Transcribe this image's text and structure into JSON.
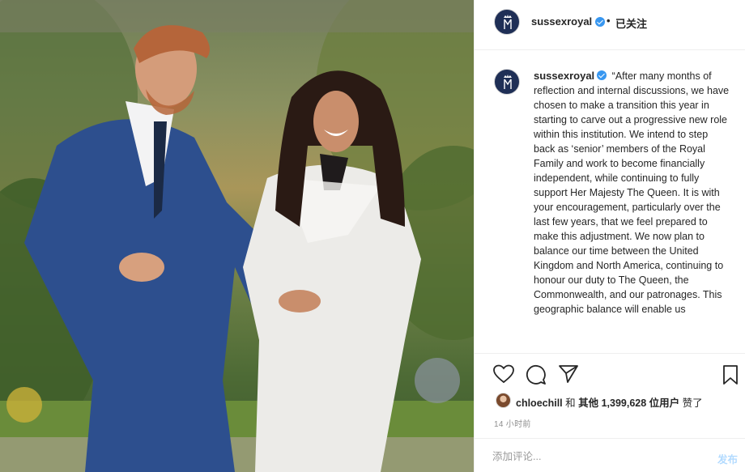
{
  "post": {
    "username": "sussexroyal",
    "follow_status": "已关注",
    "separator": "•",
    "caption_text": "“After many months of reflection and internal discussions, we have chosen to make a transition this year in starting to carve out a progressive new role within this institution. We intend to step back as ‘senior’ members of the Royal Family and work to become financially independent, while continuing to fully support Her Majesty The Queen. It is with your encouragement, particularly over the last few years, that we feel prepared to make this adjustment. We now plan to balance our time between the United Kingdom and North America, continuing to honour our duty to The Queen, the Commonwealth, and our patronages. This geographic balance will enable us",
    "likes": {
      "user": "chloechill",
      "connector": " 和 ",
      "others_prefix": "其他 ",
      "count": "1,399,628",
      "others_suffix": " 位用户",
      "verb": " 赞了"
    },
    "time_ago": "14 小时前",
    "comment_placeholder": "添加评论...",
    "post_button": "发布"
  },
  "icons": {
    "like": "heart-icon",
    "comment": "comment-bubble-icon",
    "share": "paper-plane-icon",
    "save": "bookmark-icon",
    "verified": "verified-badge-icon",
    "avatar": "royal-monogram-icon"
  },
  "colors": {
    "verified_blue": "#3897f0",
    "avatar_navy": "#1f2f56",
    "post_button_disabled": "#b3dbff",
    "timestamp_gray": "#8e8e8e"
  }
}
